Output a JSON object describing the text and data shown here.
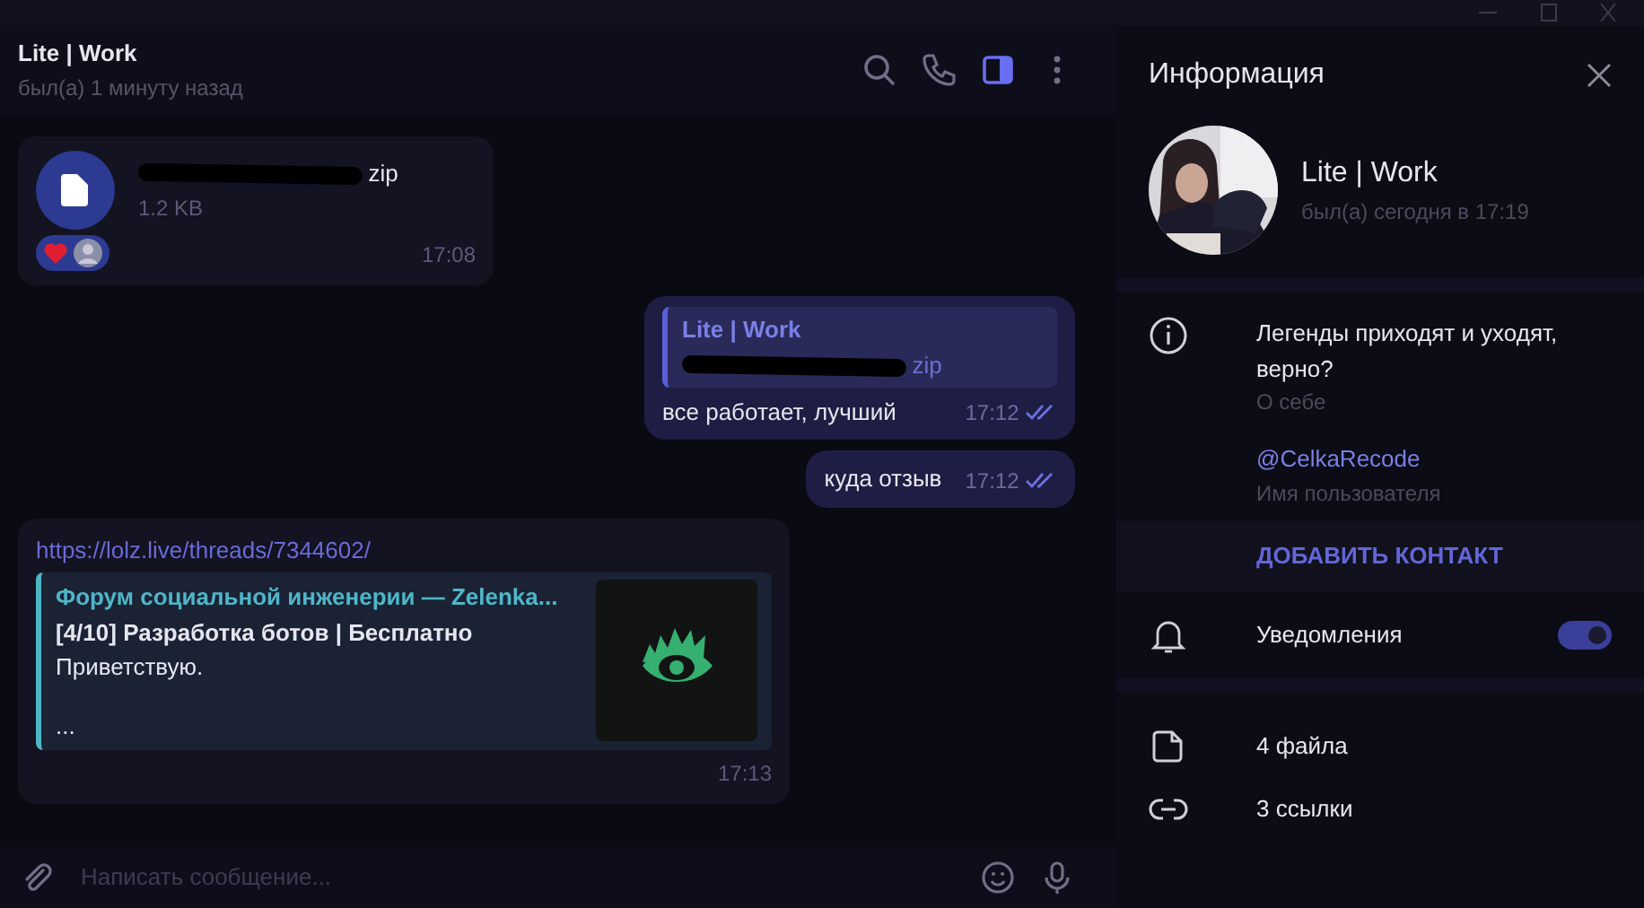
{
  "chat": {
    "title": "Lite | Work",
    "status": "был(а) 1 минуту назад"
  },
  "messages": [
    {
      "kind": "file",
      "outgoing": false,
      "name": "zip",
      "size": "1.2 KB",
      "reactions": true,
      "time": "17:08"
    },
    {
      "kind": "text",
      "outgoing": true,
      "reply": {
        "author": "Lite | Work",
        "text": "zip"
      },
      "text": "все работает, лучший",
      "time": "17:12",
      "read": true
    },
    {
      "kind": "text",
      "outgoing": true,
      "text": "куда отзыв",
      "time": "17:12",
      "read": true
    },
    {
      "kind": "link",
      "outgoing": false,
      "url": "https://lolz.live/threads/7344602/",
      "preview": {
        "site": "Форум социальной инженерии —  Zelenka...",
        "title": "[4/10] Разработка ботов | Бесплатно",
        "description": "Приветствую.",
        "more": "..."
      },
      "time": "17:13"
    }
  ],
  "composer": {
    "placeholder": "Написать сообщение..."
  },
  "info": {
    "title": "Информация",
    "name": "Lite | Work",
    "status": "был(а) сегодня в 17:19",
    "bio": "Легенды приходят и уходят, верно?",
    "bio_label": "О себе",
    "username": "@CelkaRecode",
    "username_label": "Имя пользователя",
    "add_contact": "ДОБАВИТЬ КОНТАКТ",
    "notifications": {
      "label": "Уведомления",
      "on": true
    },
    "media": [
      {
        "kind": "files",
        "label": "4 файла"
      },
      {
        "kind": "links",
        "label": "3 ссылки"
      }
    ]
  }
}
